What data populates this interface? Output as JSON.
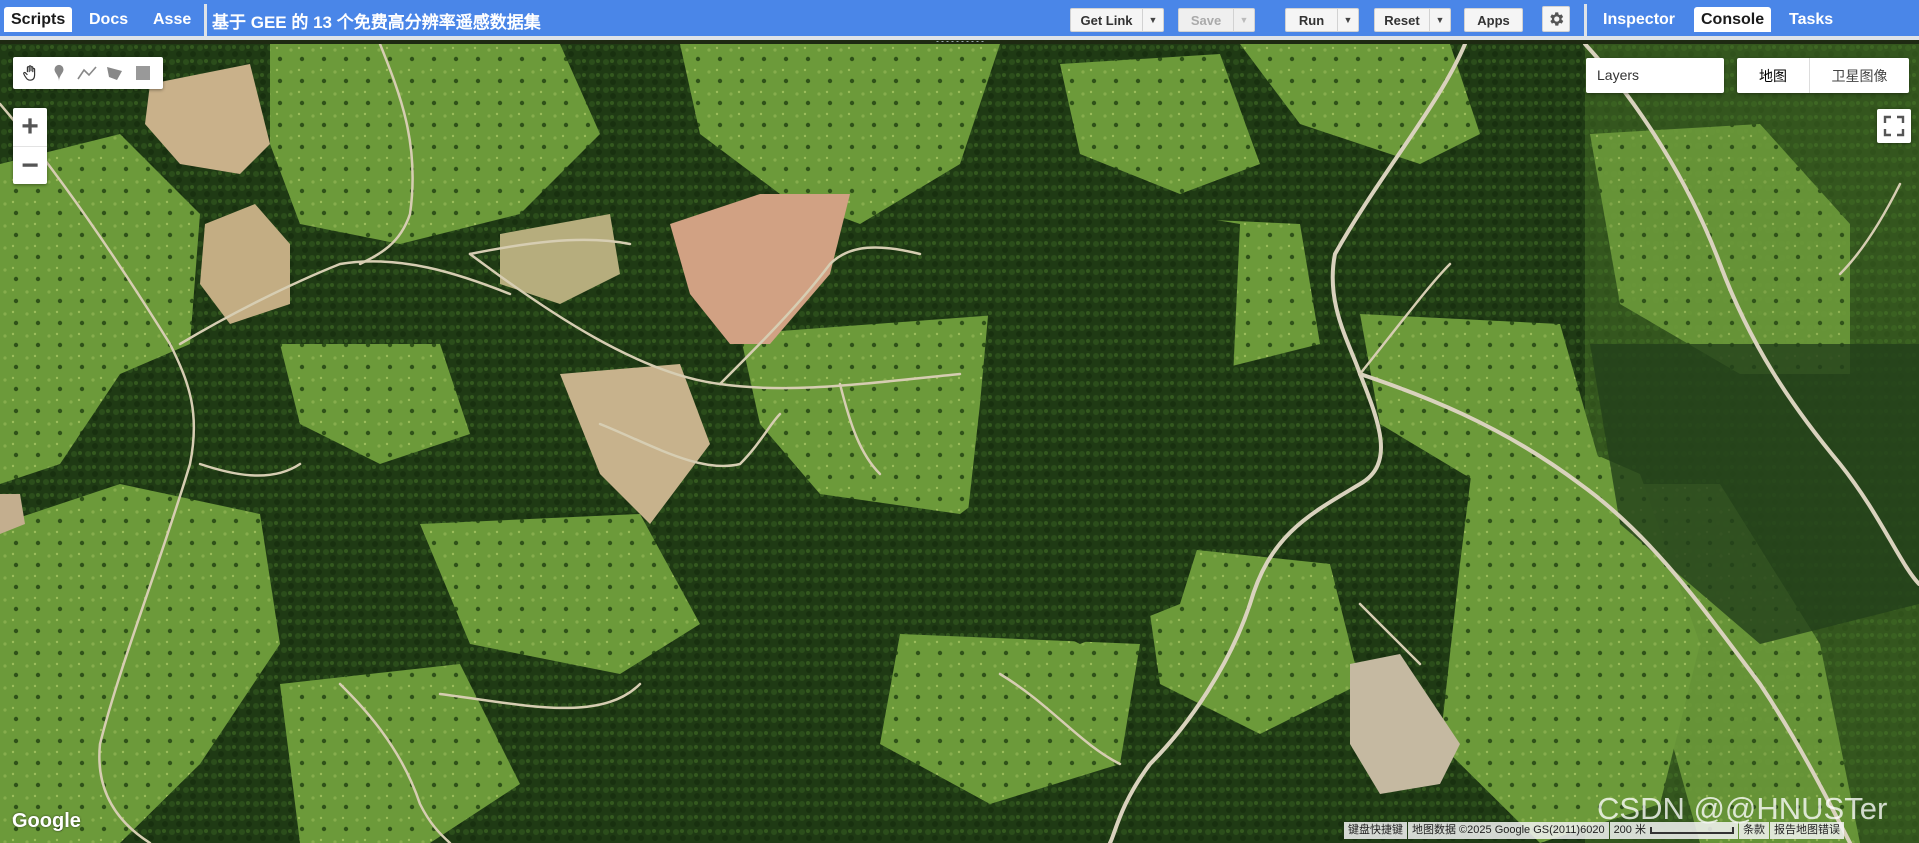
{
  "left_tabs": [
    "Scripts",
    "Docs",
    "Asse"
  ],
  "script_title": "基于 GEE 的 13 个免费高分辨率遥感数据集",
  "toolbar": {
    "get_link": "Get Link",
    "save": "Save",
    "run": "Run",
    "reset": "Reset",
    "apps": "Apps"
  },
  "right_tabs": [
    "Inspector",
    "Console",
    "Tasks"
  ],
  "map": {
    "layers_label": "Layers",
    "map_type_map": "地图",
    "map_type_satellite": "卫星图像",
    "zoom_in": "+",
    "zoom_out": "−",
    "google_logo": "Google",
    "watermark": "CSDN @@HNUSTer",
    "attribution": {
      "shortcuts": "键盘快捷键",
      "map_data": "地图数据 ©2025 Google GS(2011)6020",
      "scale": "200 米",
      "terms": "条款",
      "report": "报告地图错误"
    }
  },
  "colors": {
    "header_blue": "#4a86e8",
    "forest_dark": "#1f3a14",
    "meadow": "#6c9a3a",
    "clearing": "#c8a57c",
    "road": "#d9d2bd"
  },
  "icons": [
    "hand-icon",
    "marker-icon",
    "polyline-icon",
    "polygon-icon",
    "rectangle-icon",
    "gear-icon",
    "fullscreen-icon"
  ]
}
